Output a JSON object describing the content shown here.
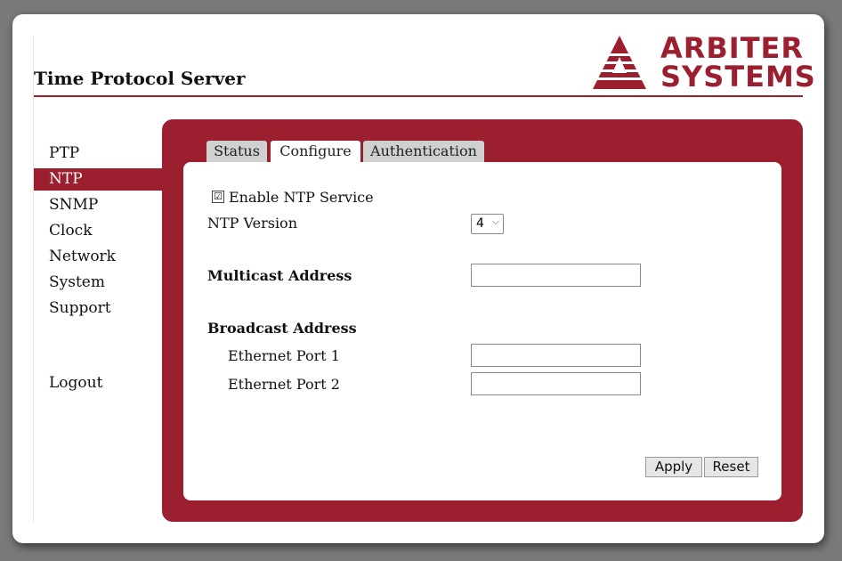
{
  "header": {
    "title": "Time Protocol Server",
    "logo": {
      "line1": "ARBITER",
      "line2": "SYSTEMS",
      "brand_color": "#9b1f2e"
    }
  },
  "sidebar": {
    "items": [
      {
        "label": "PTP",
        "active": false
      },
      {
        "label": "NTP",
        "active": true
      },
      {
        "label": "SNMP",
        "active": false
      },
      {
        "label": "Clock",
        "active": false
      },
      {
        "label": "Network",
        "active": false
      },
      {
        "label": "System",
        "active": false
      },
      {
        "label": "Support",
        "active": false
      }
    ],
    "logout": "Logout"
  },
  "tabs": [
    {
      "label": "Status",
      "active": false
    },
    {
      "label": "Configure",
      "active": true
    },
    {
      "label": "Authentication",
      "active": false
    }
  ],
  "form": {
    "enable_ntp": {
      "label": "Enable NTP Service",
      "checked": true,
      "check_glyph": "☑"
    },
    "ntp_version": {
      "label": "NTP Version",
      "value": "4",
      "chevron": "⌵"
    },
    "multicast": {
      "label": "Multicast Address",
      "value": ""
    },
    "broadcast": {
      "label": "Broadcast Address",
      "port1": {
        "label": "Ethernet Port 1",
        "value": ""
      },
      "port2": {
        "label": "Ethernet Port 2",
        "value": ""
      }
    }
  },
  "buttons": {
    "apply": "Apply",
    "reset": "Reset"
  },
  "colors": {
    "accent": "#9b1f2e",
    "tab_inactive": "#d0d0d0",
    "background": "#7a7a7a"
  }
}
